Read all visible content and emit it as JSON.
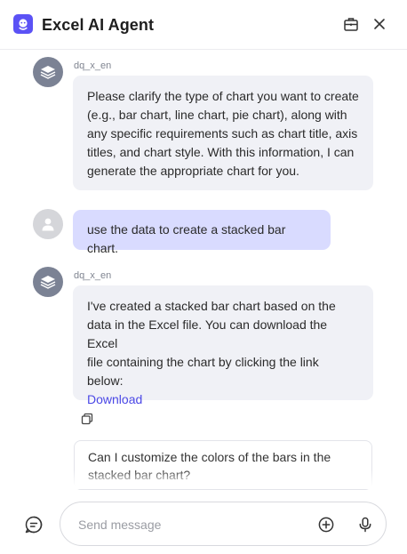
{
  "header": {
    "title": "Excel AI Agent",
    "logo_icon": "robot-icon",
    "tool_icon": "toolbox-icon",
    "close_icon": "close-icon",
    "accent_color": "#5b52f5"
  },
  "messages": [
    {
      "role": "bot",
      "sender": "dq_x_en",
      "lines": [
        "Please clarify the type of chart you want to create",
        "(e.g., bar chart, line chart, pie chart), along with",
        "any specific requirements such as chart title, axis",
        "titles, and chart style. With this information, I can",
        "generate the appropriate chart for you."
      ]
    },
    {
      "role": "user",
      "text": "use the data to create a stacked bar chart."
    },
    {
      "role": "bot",
      "sender": "dq_x_en",
      "lines": [
        "I've created a stacked bar chart based on the",
        "data in the Excel file. You can download the Excel",
        "file containing the chart by clicking the link",
        "below:"
      ],
      "link": "Download"
    }
  ],
  "actions": {
    "copy_icon": "copy-icon"
  },
  "suggestion": {
    "lines": [
      "Can I customize the colors of the bars in the",
      "stacked bar chart?"
    ]
  },
  "composer": {
    "new_chat_icon": "new-chat-icon",
    "placeholder": "Send message",
    "value": "",
    "attach_icon": "plus-circle-icon",
    "mic_icon": "microphone-icon"
  }
}
